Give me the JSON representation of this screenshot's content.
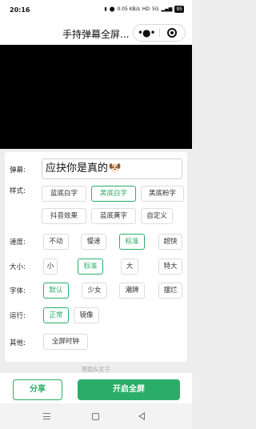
{
  "status_bar": {
    "time": "20:16",
    "speed": "0.05 KB/s",
    "network": "HD",
    "signal": "5G",
    "battery": "95"
  },
  "title_bar": {
    "title": "手持弹幕全屏...",
    "more_icon": "ellipsis-icon",
    "close_icon": "target-close-icon"
  },
  "danmu": {
    "label": "弹幕:",
    "text": "应抉你是真的",
    "emoji": "dog-face-icon"
  },
  "style": {
    "label": "样式:",
    "options": [
      "蓝底白字",
      "黑底白字",
      "黑底粉字",
      "抖音效果",
      "蓝底黄字",
      "自定义"
    ],
    "selected": "黑底白字"
  },
  "speed": {
    "label": "速度:",
    "options": [
      "不动",
      "慢速",
      "标准",
      "超快"
    ],
    "selected": "标准"
  },
  "size": {
    "label": "大小:",
    "options": [
      "小",
      "标准",
      "大",
      "特大"
    ],
    "selected": "标准"
  },
  "font": {
    "label": "字体:",
    "options": [
      "默认",
      "少女",
      "潮牌",
      "摆烂"
    ],
    "selected": "默认"
  },
  "run": {
    "label": "运行:",
    "options": [
      "正常",
      "镜像"
    ],
    "selected": "正常"
  },
  "other": {
    "label": "其他:",
    "options": [
      "全屏时钟"
    ]
  },
  "help": "帮助&关于",
  "actions": {
    "share": "分享",
    "fullscreen": "开启全屏"
  },
  "accent_color": "#2aae67"
}
